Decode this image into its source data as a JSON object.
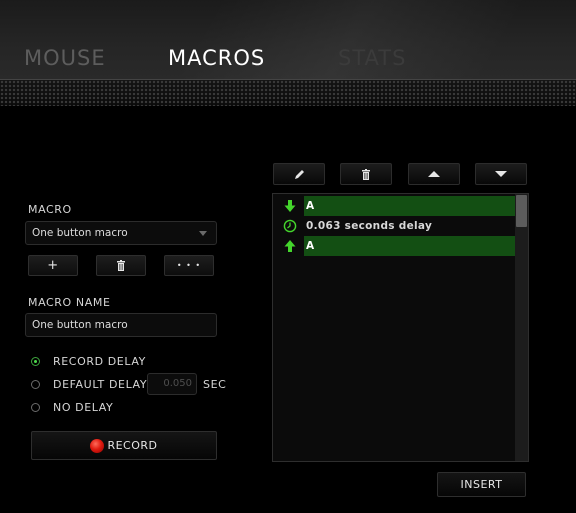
{
  "tabs": [
    {
      "label": "MOUSE",
      "active": false
    },
    {
      "label": "MACROS",
      "active": true
    },
    {
      "label": "STATS",
      "active": false
    }
  ],
  "macro": {
    "section_label": "MACRO",
    "selected": "One button macro",
    "add_label": "+",
    "more_label": "• • •"
  },
  "macro_name": {
    "label": "MACRO NAME",
    "value": "One button macro"
  },
  "delay_options": {
    "record_delay": "RECORD DELAY",
    "default_delay": "DEFAULT DELAY",
    "default_delay_value": "0.050",
    "unit": "SEC",
    "no_delay": "NO DELAY",
    "selected": "record_delay"
  },
  "record_button": "RECORD",
  "insert_button": "INSERT",
  "events": [
    {
      "type": "key-down",
      "icon": "arrow-down-icon",
      "text": "A",
      "highlighted": true
    },
    {
      "type": "delay",
      "icon": "clock-icon",
      "text": "0.063 seconds delay",
      "highlighted": false
    },
    {
      "type": "key-up",
      "icon": "arrow-up-icon",
      "text": "A",
      "highlighted": true
    }
  ],
  "colors": {
    "accent_green": "#44d62c",
    "row_highlight": "#134f13",
    "record_red": "#e01b10"
  }
}
